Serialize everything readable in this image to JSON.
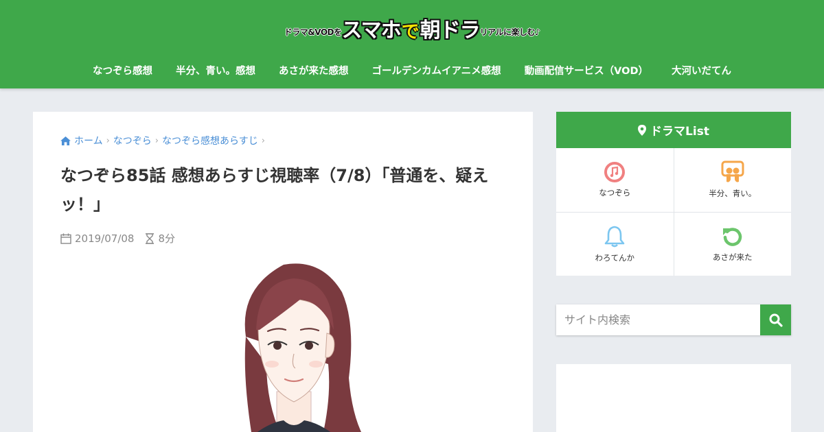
{
  "header": {
    "logo": {
      "prefix": "ドラマ&VODを",
      "part1": "スマホ",
      "de": "で",
      "part2": "朝ドラ",
      "suffix": "リアルに楽しむ♪"
    },
    "nav": [
      {
        "label": "なつぞら感想"
      },
      {
        "label": "半分、青い。感想"
      },
      {
        "label": "あさが来た感想"
      },
      {
        "label": "ゴールデンカムイアニメ感想"
      },
      {
        "label": "動画配信サービス（VOD）"
      },
      {
        "label": "大河いだてん"
      }
    ]
  },
  "article": {
    "breadcrumb": [
      "ホーム",
      "なつぞら",
      "なつぞら感想あらすじ"
    ],
    "title": "なつぞら85話 感想あらすじ視聴率（7/8）「普通を、疑えッ！」",
    "date": "2019/07/08",
    "read_time": "8分"
  },
  "sidebar": {
    "widget_title": "ドラマList",
    "items": [
      {
        "label": "なつぞら",
        "icon": "music-disc-icon",
        "color": "#f08080"
      },
      {
        "label": "半分、青い。",
        "icon": "slideshare-icon",
        "color": "#f5a64a"
      },
      {
        "label": "わろてんか",
        "icon": "bell-icon",
        "color": "#7cc6f0"
      },
      {
        "label": "あさが来た",
        "icon": "refresh-icon",
        "color": "#6cc56c"
      }
    ],
    "search": {
      "placeholder": "サイト内検索"
    }
  },
  "colors": {
    "brand": "#3fa84a",
    "link": "#4b8fd6",
    "background": "#e9ecf0"
  }
}
